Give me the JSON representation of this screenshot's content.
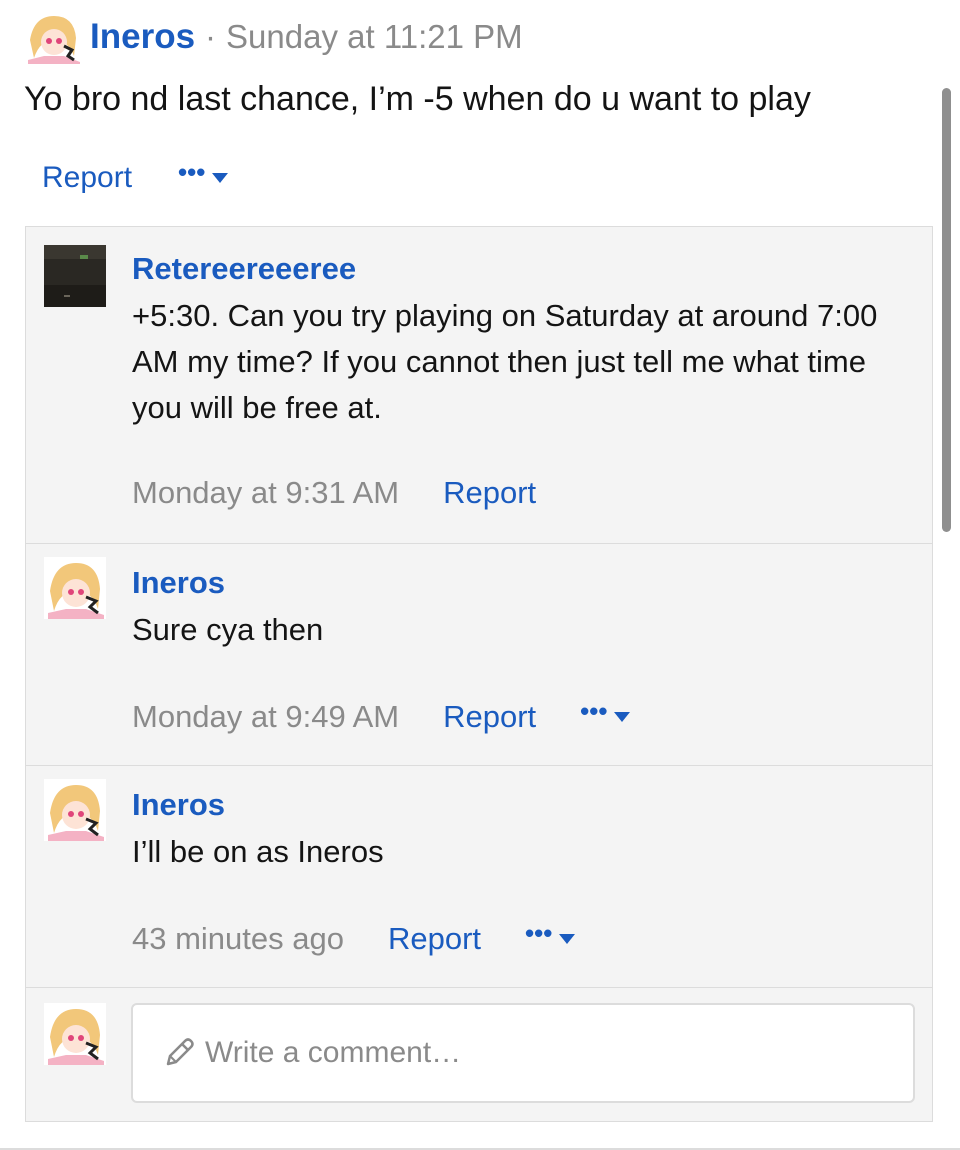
{
  "post": {
    "author": "Ineros",
    "separator": "·",
    "timestamp": "Sunday at 11:21 PM",
    "body": "Yo bro nd last chance, I’m -5 when do u want to play",
    "report_label": "Report",
    "more_label": "•••"
  },
  "comments": [
    {
      "author": "Retereereeeree",
      "text": "+5:30. Can you try playing on Saturday at around 7:00 AM my time? If you cannot then just tell me what time you will be free at.",
      "time": "Monday at 9:31 AM",
      "report_label": "Report"
    },
    {
      "author": "Ineros",
      "text": "Sure cya then",
      "time": "Monday at 9:49 AM",
      "report_label": "Report",
      "more_label": "•••"
    },
    {
      "author": "Ineros",
      "text": "I’ll be on as Ineros",
      "time": "43 minutes ago",
      "report_label": "Report",
      "more_label": "•••"
    }
  ],
  "composer": {
    "placeholder": "Write a comment…"
  },
  "icons": {
    "pencil": "pencil-icon",
    "caret": "caret-down-icon",
    "more": "more-dots-icon"
  },
  "colors": {
    "link": "#1a5bbf",
    "muted": "#8a8a8a",
    "panel": "#f4f4f4"
  }
}
